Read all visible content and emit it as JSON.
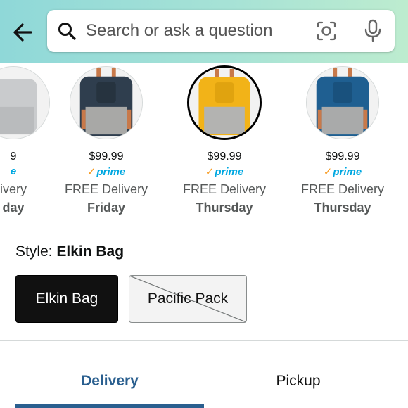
{
  "search": {
    "placeholder": "Search or ask a question"
  },
  "icons": {
    "back": "back-arrow-icon",
    "search": "search-icon",
    "camera": "camera-lens-icon",
    "mic": "microphone-icon"
  },
  "carousel": {
    "items": [
      {
        "price": "9",
        "prime": "e",
        "delivery": "ivery",
        "day": "day",
        "color": "#c9cbcd"
      },
      {
        "price": "$99.99",
        "prime": "prime",
        "delivery": "FREE Delivery",
        "day": "Friday",
        "color": "#2f3e4e"
      },
      {
        "price": "$99.99",
        "prime": "prime",
        "delivery": "FREE Delivery",
        "day": "Thursday",
        "color": "#f2b318",
        "selected": true
      },
      {
        "price": "$99.99",
        "prime": "prime",
        "delivery": "FREE Delivery",
        "day": "Thursday",
        "color": "#1f5f91"
      }
    ]
  },
  "style": {
    "label": "Style:",
    "value": "Elkin Bag",
    "options": [
      {
        "label": "Elkin Bag",
        "state": "selected"
      },
      {
        "label": "Pacific Pack",
        "state": "unavailable"
      }
    ]
  },
  "tabs": [
    {
      "label": "Delivery",
      "active": true
    },
    {
      "label": "Pickup",
      "active": false
    }
  ],
  "colors": {
    "header_gradient_start": "#8fd8d8",
    "header_gradient_end": "#bdeccf",
    "prime_blue": "#00a8e1",
    "prime_check": "#f79b22",
    "active_tab": "#2a5f8f"
  }
}
